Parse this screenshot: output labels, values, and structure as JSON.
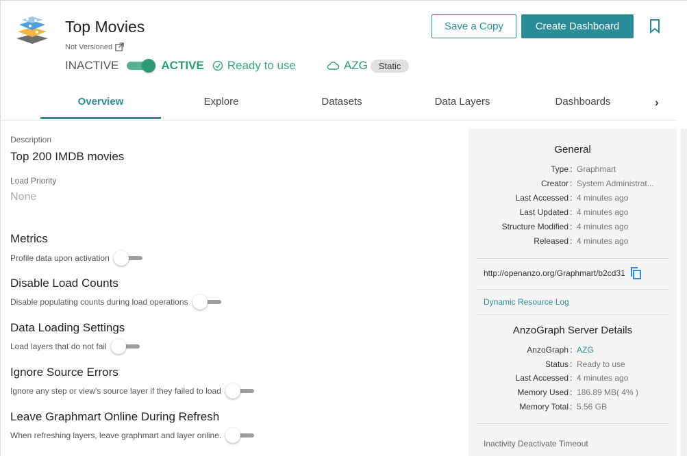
{
  "header": {
    "title": "Top Movies",
    "version_label": "Not Versioned",
    "inactive_label": "INACTIVE",
    "active_label": "ACTIVE",
    "ready_label": "Ready to use",
    "server_name": "AZG",
    "server_badge": "Static",
    "save_copy_label": "Save a Copy",
    "create_dashboard_label": "Create Dashboard",
    "toggle_state": "on",
    "accent_color": "#2a8c96",
    "active_color": "#2f9a78"
  },
  "tabs": [
    {
      "label": "Overview",
      "active": true
    },
    {
      "label": "Explore",
      "active": false
    },
    {
      "label": "Datasets",
      "active": false
    },
    {
      "label": "Data Layers",
      "active": false
    },
    {
      "label": "Dashboards",
      "active": false
    }
  ],
  "tabs_next_glyph": "›",
  "overview": {
    "description_label": "Description",
    "description_value": "Top 200 IMDB movies",
    "load_priority_label": "Load Priority",
    "load_priority_value": "None",
    "settings": [
      {
        "title": "Metrics",
        "desc": "Profile data upon activation",
        "enabled": false
      },
      {
        "title": "Disable Load Counts",
        "desc": "Disable populating counts during load operations",
        "enabled": false
      },
      {
        "title": "Data Loading Settings",
        "desc": "Load layers that do not fail",
        "enabled": false
      },
      {
        "title": "Ignore Source Errors",
        "desc": "Ignore any step or view's source layer if they failed to load",
        "enabled": false
      },
      {
        "title": "Leave Graphmart Online During Refresh",
        "desc": "When refreshing layers, leave graphmart and layer online.",
        "enabled": false
      }
    ]
  },
  "panel": {
    "general_title": "General",
    "general": [
      {
        "key": "Type",
        "value": "Graphmart"
      },
      {
        "key": "Creator",
        "value": "System Administrat..."
      },
      {
        "key": "Last Accessed",
        "value": "4 minutes ago"
      },
      {
        "key": "Last Updated",
        "value": "4 minutes ago"
      },
      {
        "key": "Structure Modified",
        "value": "4 minutes ago"
      },
      {
        "key": "Released",
        "value": "4 minutes ago"
      }
    ],
    "uri": "http://openanzo.org/Graphmart/b2cd31",
    "resource_log_label": "Dynamic Resource Log",
    "server_title": "AnzoGraph Server Details",
    "server": [
      {
        "key": "AnzoGraph",
        "value": "AZG",
        "link": true
      },
      {
        "key": "Status",
        "value": "Ready to use",
        "link": false
      },
      {
        "key": "Last Accessed",
        "value": "4 minutes ago",
        "link": false
      },
      {
        "key": "Memory Used",
        "value": "186.89 MB( 4% )",
        "link": false
      },
      {
        "key": "Memory Total",
        "value": "5.56 GB",
        "link": false
      }
    ],
    "inactivity_label": "Inactivity Deactivate Timeout",
    "separator": ":"
  },
  "icons": [
    "graphmart-logo-icon",
    "external-link-icon",
    "check-circle-icon",
    "cloud-icon",
    "bookmark-icon",
    "chevron-right-icon",
    "copy-icon"
  ]
}
